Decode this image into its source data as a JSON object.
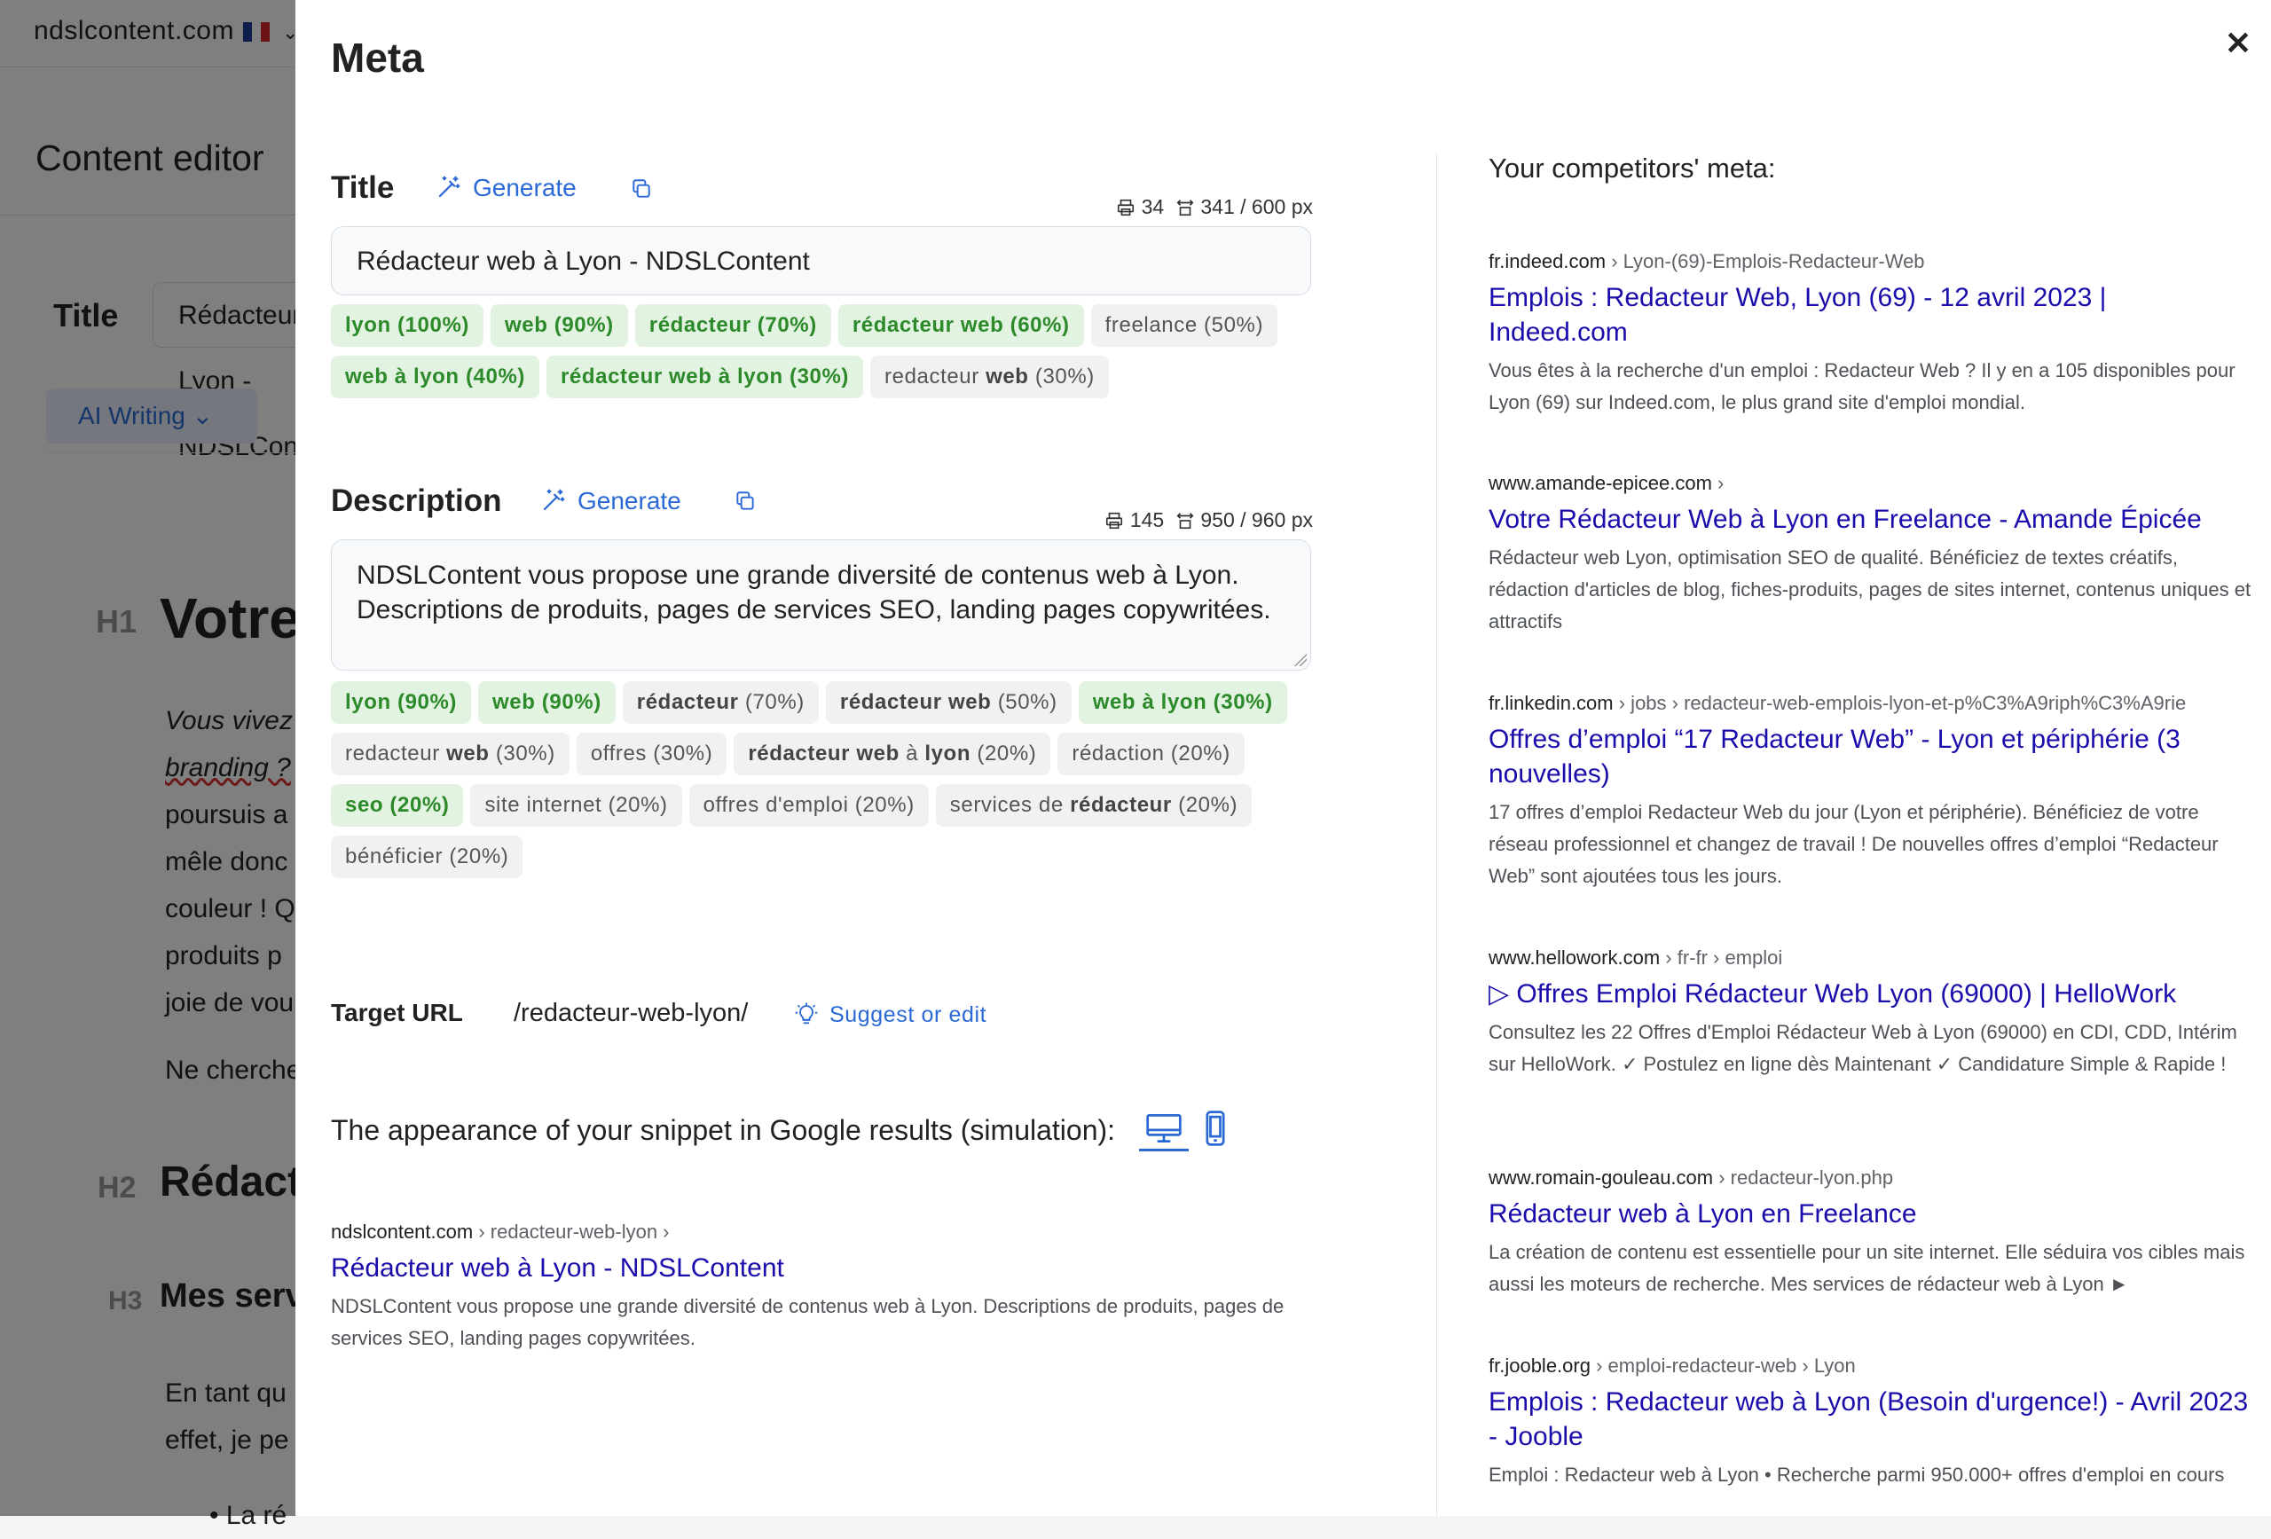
{
  "background": {
    "site": "ndslcontent.com",
    "editor_title": "Content editor",
    "title_label": "Title",
    "title_value": "Rédacteur web à Lyon - NDSLContent",
    "ai_button": "AI Writing",
    "h1_tag": "H1",
    "h1_text": "Votre rédacteur web à Lyon",
    "h2_tag": "H2",
    "h2_text": "Rédacteur web",
    "h3_tag": "H3",
    "h3_text": "Mes services",
    "paragraph_lines": [
      "Vous vivez",
      "branding ?",
      "poursuis a",
      "mêle donc",
      "couleur ! Q",
      "produits p",
      "joie de vou"
    ],
    "paragraph2": "Ne cherche",
    "paragraph3_lines": [
      "En tant qu",
      "effet, je pe"
    ],
    "bullet": "La ré"
  },
  "modal": {
    "title": "Meta",
    "title_section": {
      "label": "Title",
      "generate": "Generate",
      "char_count": "34",
      "px_count": "341 / 600 px",
      "value": "Rédacteur web à Lyon - NDSLContent",
      "keywords": [
        {
          "text": "lyon (100%)",
          "status": "green"
        },
        {
          "text": "web (90%)",
          "status": "green"
        },
        {
          "text": "rédacteur (70%)",
          "status": "green"
        },
        {
          "text": "rédacteur web (60%)",
          "status": "green"
        },
        {
          "text": "freelance (50%)",
          "status": "neutral"
        },
        {
          "text": "web à lyon (40%)",
          "status": "green"
        },
        {
          "text": "rédacteur web à lyon (30%)",
          "status": "green"
        },
        {
          "pre": "redacteur ",
          "bold": "web",
          "post": " (30%)",
          "status": "neutral"
        }
      ]
    },
    "description_section": {
      "label": "Description",
      "generate": "Generate",
      "char_count": "145",
      "px_count": "950 / 960 px",
      "value": "NDSLContent vous propose une grande diversité de contenus web à Lyon. Descriptions de produits, pages de services SEO, landing pages copywritées.",
      "keywords": [
        {
          "text": "lyon (90%)",
          "status": "green"
        },
        {
          "text": "web (90%)",
          "status": "green"
        },
        {
          "pre": "",
          "bold": "rédacteur",
          "post": " (70%)",
          "status": "neutral"
        },
        {
          "pre": "",
          "bold": "rédacteur web",
          "post": " (50%)",
          "status": "neutral"
        },
        {
          "text": "web à lyon (30%)",
          "status": "green"
        },
        {
          "pre": "redacteur ",
          "bold": "web",
          "post": " (30%)",
          "status": "neutral"
        },
        {
          "text": "offres (30%)",
          "status": "neutral"
        },
        {
          "pre": "",
          "bold": "rédacteur web",
          "post": " à ",
          "bold2": "lyon",
          "post2": " (20%)",
          "status": "neutral"
        },
        {
          "text": "rédaction (20%)",
          "status": "neutral"
        },
        {
          "text": "seo (20%)",
          "status": "green"
        },
        {
          "text": "site internet (20%)",
          "status": "neutral"
        },
        {
          "text": "offres d'emploi (20%)",
          "status": "neutral"
        },
        {
          "pre": "services de ",
          "bold": "rédacteur",
          "post": " (20%)",
          "status": "neutral"
        },
        {
          "text": "bénéficier (20%)",
          "status": "neutral"
        }
      ]
    },
    "target_url": {
      "label": "Target URL",
      "value": "/redacteur-web-lyon/",
      "suggest": "Suggest or edit"
    },
    "snippet_heading": "The appearance of your snippet in Google results (simulation):",
    "snippet": {
      "domain": "ndslcontent.com",
      "path": " › redacteur-web-lyon ›",
      "title": "Rédacteur web à Lyon - NDSLContent",
      "description": "NDSLContent vous propose une grande diversité de contenus web à Lyon. Descriptions de produits, pages de services SEO, landing pages copywritées."
    },
    "competitors_heading": "Your competitors' meta:",
    "competitors": [
      {
        "domain": "fr.indeed.com",
        "path": " › Lyon-(69)-Emplois-Redacteur-Web",
        "title": "Emplois : Redacteur Web, Lyon (69) - 12 avril 2023 | Indeed.com",
        "description": "Vous êtes à la recherche d'un emploi : Redacteur Web ? Il y en a 105 disponibles pour Lyon (69) sur Indeed.com, le plus grand site d'emploi mondial."
      },
      {
        "domain": "www.amande-epicee.com",
        "path": " ›",
        "title": "Votre Rédacteur Web à Lyon en Freelance - Amande Épicée",
        "description": "Rédacteur web Lyon, optimisation SEO de qualité. Bénéficiez de textes créatifs, rédaction d'articles de blog, fiches-produits, pages de sites internet, contenus uniques et attractifs"
      },
      {
        "domain": "fr.linkedin.com",
        "path": " › jobs › redacteur-web-emplois-lyon-et-p%C3%A9riph%C3%A9rie",
        "title": "Offres d’emploi “17 Redacteur Web” - Lyon et périphérie (3 nouvelles)",
        "description": "17 offres d’emploi Redacteur Web du jour (Lyon et périphérie). Bénéficiez de votre réseau professionnel et changez de travail ! De nouvelles offres d’emploi “Redacteur Web” sont ajoutées tous les jours."
      },
      {
        "domain": "www.hellowork.com",
        "path": " › fr-fr › emploi",
        "title": "▷ Offres Emploi Rédacteur Web Lyon (69000) | HelloWork",
        "description": "Consultez les 22 Offres d'Emploi Rédacteur Web à Lyon (69000) en CDI, CDD, Intérim sur HelloWork. ✓ Postulez en ligne dès Maintenant ✓ Candidature Simple & Rapide !"
      },
      {
        "domain": "www.romain-gouleau.com",
        "path": " › redacteur-lyon.php",
        "title": "Rédacteur web à Lyon en Freelance",
        "description": "La création de contenu est essentielle pour un site internet. Elle séduira vos cibles mais aussi les moteurs de recherche. Mes services de rédacteur web à Lyon ►"
      },
      {
        "domain": "fr.jooble.org",
        "path": " › emploi-redacteur-web › Lyon",
        "title": "Emplois : Redacteur web à Lyon (Besoin d'urgence!) - Avril 2023 - Jooble",
        "description": "Emploi : Redacteur web à Lyon • Recherche parmi 950.000+ offres d'emploi en cours"
      }
    ]
  }
}
